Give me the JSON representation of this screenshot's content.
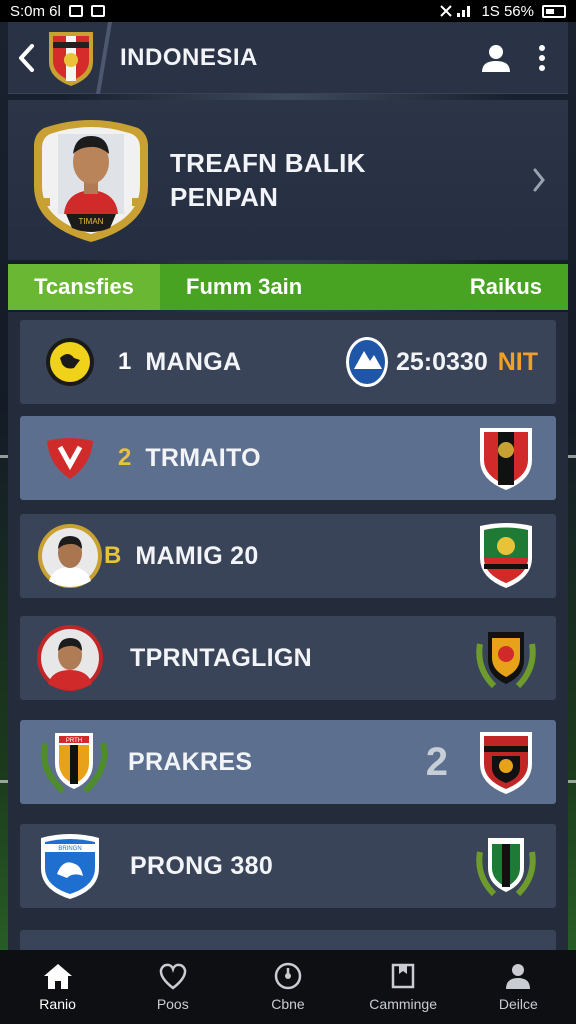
{
  "status_bar": {
    "time": "S:0m 6l",
    "right_text": "1S 56%"
  },
  "header": {
    "title": "INDONESIA"
  },
  "profile": {
    "name_line1": "TREAFN BALIK",
    "name_line2": "PENPAN",
    "badge_text": "TIMAN"
  },
  "tabs": [
    {
      "label": "Tcansfies",
      "active": true
    },
    {
      "label": "Fumm 3ain",
      "active": false
    },
    {
      "label": "Raikus",
      "active": false
    }
  ],
  "rows": [
    {
      "rank": "1",
      "name": "MANGA",
      "score": "25:0330",
      "score_unit": "NIT",
      "highlight": false
    },
    {
      "rank": "2",
      "name": "TRMAITO",
      "highlight": true
    },
    {
      "rank": "B",
      "name": "MAMIG 20",
      "highlight": false
    },
    {
      "rank": "",
      "name": "TPRNTAGLIGN",
      "highlight": false
    },
    {
      "rank": "",
      "name": "PRAKRES",
      "arrow": "2",
      "highlight": true
    },
    {
      "rank": "",
      "name": "PRONG 380",
      "highlight": false
    }
  ],
  "crest_texts": {
    "row5_left": "PRTH",
    "row6_left": "BRINGN"
  },
  "bottom_nav": [
    {
      "label": "Ranio",
      "icon": "home-icon",
      "active": true
    },
    {
      "label": "Poos",
      "icon": "heart-icon",
      "active": false
    },
    {
      "label": "Cbne",
      "icon": "clock-icon",
      "active": false
    },
    {
      "label": "Camminge",
      "icon": "bookmark-icon",
      "active": false
    },
    {
      "label": "Deilce",
      "icon": "profile-icon",
      "active": false
    }
  ],
  "colors": {
    "accent_green": "#49a323",
    "active_tab_green": "#6ab734",
    "row_highlight": "#5c6f8e",
    "score_unit_orange": "#f0a028",
    "rank_gold": "#e8c33a"
  }
}
